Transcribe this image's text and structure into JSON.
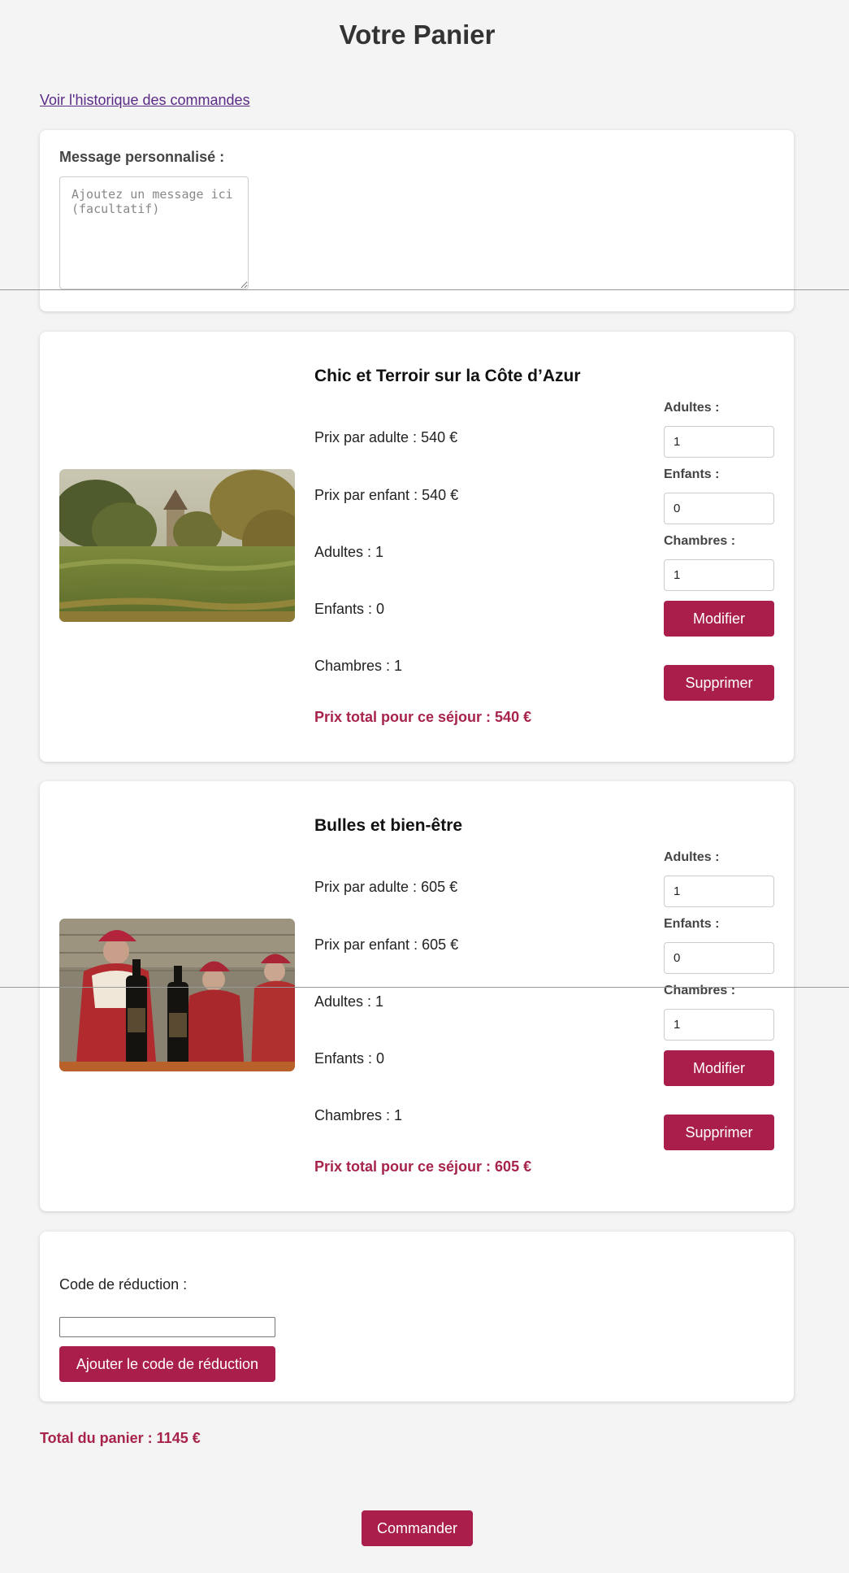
{
  "page": {
    "title": "Votre Panier",
    "history_link": "Voir l'historique des commandes"
  },
  "message": {
    "label": "Message personnalisé :",
    "placeholder": "Ajoutez un message ici (facultatif)",
    "value": ""
  },
  "trips": [
    {
      "title": "Chic et Terroir sur la Côte d’Azur",
      "image_icon": "vineyard-photo",
      "price_adult": "Prix par adulte : 540 €",
      "price_child": "Prix par enfant : 540 €",
      "adults_line": "Adultes : 1",
      "children_line": "Enfants : 0",
      "rooms_line": "Chambres : 1",
      "total": "Prix total pour ce séjour : 540 €",
      "labels": {
        "adults": "Adultes :",
        "children": "Enfants :",
        "rooms": "Chambres :"
      },
      "inputs": {
        "adults": "1",
        "children": "0",
        "rooms": "1"
      },
      "modify_label": "Modifier",
      "delete_label": "Supprimer"
    },
    {
      "title": "Bulles et bien-être",
      "image_icon": "champagne-bottles-photo",
      "price_adult": "Prix par adulte : 605 €",
      "price_child": "Prix par enfant : 605 €",
      "adults_line": "Adultes : 1",
      "children_line": "Enfants : 0",
      "rooms_line": "Chambres : 1",
      "total": "Prix total pour ce séjour : 605 €",
      "labels": {
        "adults": "Adultes :",
        "children": "Enfants :",
        "rooms": "Chambres :"
      },
      "inputs": {
        "adults": "1",
        "children": "0",
        "rooms": "1"
      },
      "modify_label": "Modifier",
      "delete_label": "Supprimer"
    }
  ],
  "discount": {
    "label": "Code de réduction :",
    "value": "",
    "button_label": "Ajouter le code de réduction"
  },
  "cart": {
    "total": "Total du panier : 1145 €",
    "order_label": "Commander"
  },
  "colors": {
    "accent": "#a91e4a",
    "total_text": "#a7234a",
    "link": "#5a2a86",
    "background": "#f4f4f4"
  }
}
